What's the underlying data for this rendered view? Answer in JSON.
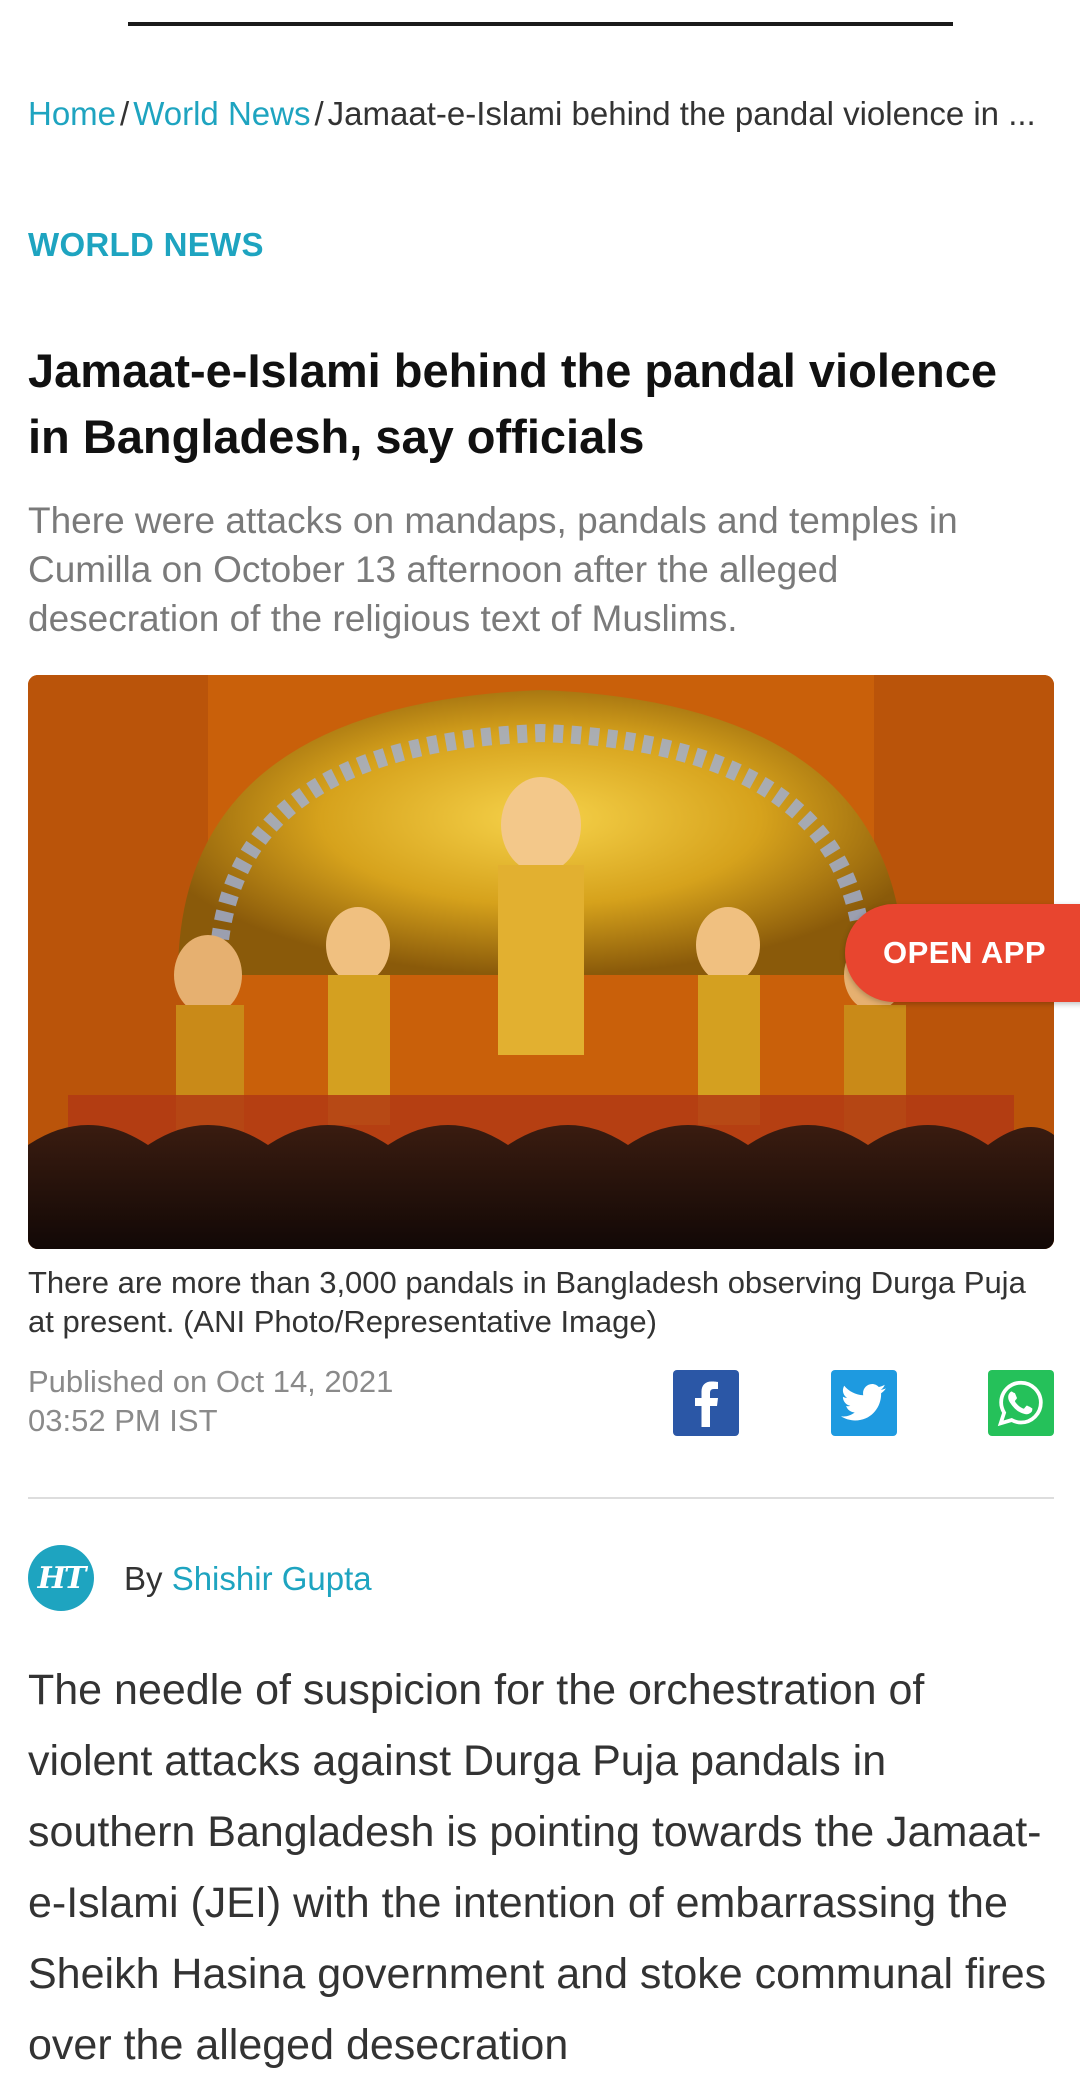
{
  "breadcrumb": {
    "home": "Home",
    "sep1": "/",
    "section": "World News",
    "sep2": "/",
    "current": "Jamaat-e-Islami behind the pandal violence in ..."
  },
  "article": {
    "section_label": "WORLD NEWS",
    "headline": "Jamaat-e-Islami behind the pandal violence in Bangladesh, say officials",
    "summary": "There were attacks on mandaps, pandals and temples in Cumilla on October 13 afternoon after the alleged desecration of the religious text of Muslims.",
    "image_caption": "There are more than 3,000 pandals in Bangladesh observing Durga Puja at present. (ANI Photo/Representative Image)",
    "published_line1": "Published on Oct 14, 2021",
    "published_line2": "03:52 PM IST",
    "byline_prefix": "By",
    "author": "Shishir Gupta",
    "author_logo": "HT",
    "body": "The needle of suspicion for the orchestration of violent attacks against Durga Puja pandals in southern Bangladesh is pointing towards the Jamaat-e-Islami (JEI) with the intention of embarrassing the Sheikh Hasina government and stoke communal fires over the alleged desecration"
  },
  "open_app_label": "OPEN APP",
  "share": [
    {
      "icon": "facebook-icon",
      "color": "#2b57a6"
    },
    {
      "icon": "twitter-icon",
      "color": "#1e9ae0"
    },
    {
      "icon": "whatsapp-icon",
      "color": "#25c15a"
    }
  ],
  "colors": {
    "accent": "#1ea4c0",
    "open_app": "#e8452f"
  }
}
